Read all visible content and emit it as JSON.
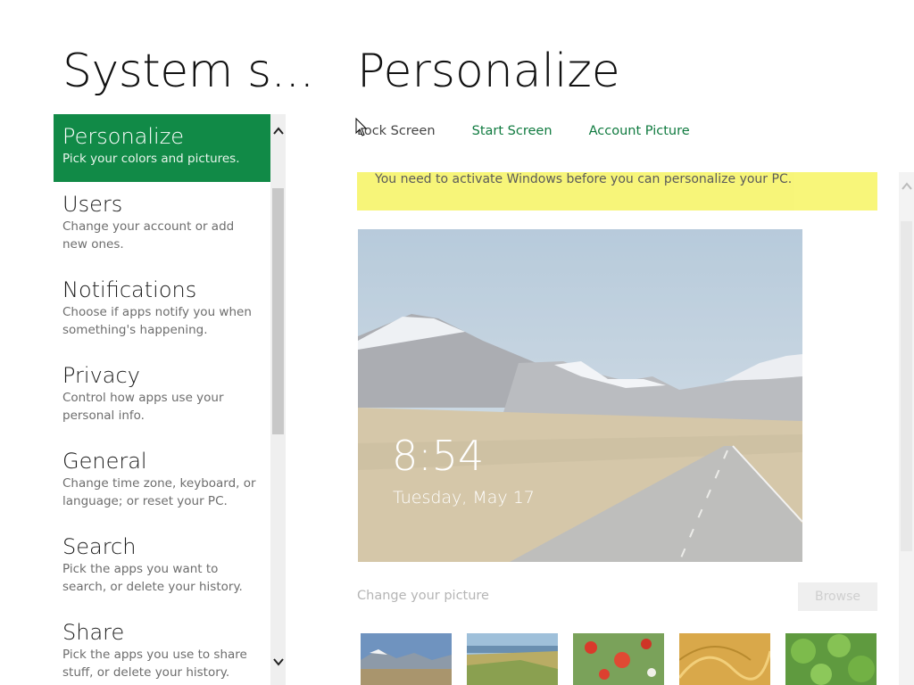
{
  "left_pane": {
    "title": "System s...",
    "items": [
      {
        "label": "Personalize",
        "desc": "Pick your colors and pictures."
      },
      {
        "label": "Users",
        "desc": "Change your account or add new ones."
      },
      {
        "label": "Notifications",
        "desc": "Choose if apps notify you when something's happening."
      },
      {
        "label": "Privacy",
        "desc": "Control how apps use your personal info."
      },
      {
        "label": "General",
        "desc": "Change time zone, keyboard, or language; or reset your PC."
      },
      {
        "label": "Search",
        "desc": "Pick the apps you want to search, or delete your history."
      },
      {
        "label": "Share",
        "desc": "Pick the apps you use to share stuff, or delete your history."
      }
    ],
    "selected_index": 0,
    "scroll_up_icon": "chevron-up-icon",
    "scroll_down_icon": "chevron-down-icon"
  },
  "right_pane": {
    "title": "Personalize",
    "tabs": [
      {
        "label": "Lock Screen",
        "active": true
      },
      {
        "label": "Start Screen",
        "active": false
      },
      {
        "label": "Account Picture",
        "active": false
      }
    ],
    "banner": "You need to activate Windows before you can personalize your PC.",
    "lock_preview": {
      "time": "8:54",
      "date": "Tuesday, May 17"
    },
    "change_label": "Change your picture",
    "browse_label": "Browse",
    "thumbnails": [
      "mountain-road",
      "green-hills",
      "red-flowers",
      "golden-grass",
      "green-leaves"
    ]
  },
  "colors": {
    "accent": "#118a47",
    "link": "#0f7a3f",
    "banner": "#f7f56b"
  }
}
